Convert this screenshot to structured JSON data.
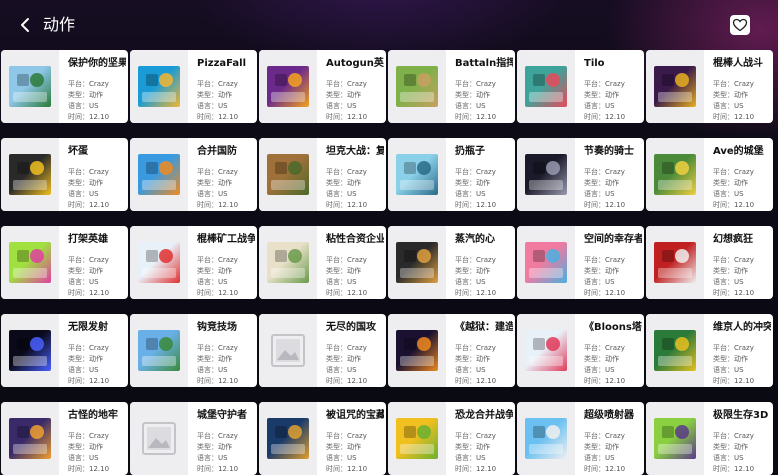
{
  "header": {
    "title": "动作"
  },
  "labels": {
    "platform": "平台：",
    "type": "类型：",
    "lang": "语言：",
    "time": "时间："
  },
  "games": [
    {
      "name": "保护你的坚果",
      "platform": "Crazy",
      "type": "动作",
      "lang": "US",
      "time": "12.10",
      "thumb": "defend-your-nuts",
      "c1": "#8ec7e8",
      "c2": "#2a7a3a"
    },
    {
      "name": "PizzaFall",
      "platform": "Crazy",
      "type": "动作",
      "lang": "US",
      "time": "12.10",
      "thumb": "pizza-fall",
      "c1": "#1a9bd6",
      "c2": "#f2b632"
    },
    {
      "name": "Autogun英雄",
      "platform": "Crazy",
      "type": "动作",
      "lang": "US",
      "time": "12.10",
      "thumb": "autogun-heroes",
      "c1": "#6b2a8a",
      "c2": "#f4a21f"
    },
    {
      "name": "Battaln指挥官",
      "platform": "Crazy",
      "type": "动作",
      "lang": "US",
      "time": "12.10",
      "thumb": "battalion-commander",
      "c1": "#7fb04a",
      "c2": "#c8a060"
    },
    {
      "name": "Tilo",
      "platform": "Crazy",
      "type": "动作",
      "lang": "US",
      "time": "12.10",
      "thumb": "tilo",
      "c1": "#3ea39a",
      "c2": "#e84a5a"
    },
    {
      "name": "棍棒人战斗",
      "platform": "Crazy",
      "type": "动作",
      "lang": "US",
      "time": "12.10",
      "thumb": "stickman-fighting",
      "c1": "#3a1a4a",
      "c2": "#e8b020"
    },
    {
      "name": "坏蛋",
      "platform": "Crazy",
      "type": "动作",
      "lang": "US",
      "time": "12.10",
      "thumb": "bad-egg",
      "c1": "#2a2a2a",
      "c2": "#f0c020"
    },
    {
      "name": "合并国防",
      "platform": "Crazy",
      "type": "动作",
      "lang": "US",
      "time": "12.10",
      "thumb": "merge-defense",
      "c1": "#3a9ae0",
      "c2": "#f08a20"
    },
    {
      "name": "坦克大战：复仇",
      "platform": "Crazy",
      "type": "动作",
      "lang": "US",
      "time": "12.10",
      "thumb": "tank-war",
      "c1": "#a0703a",
      "c2": "#4a6a2a"
    },
    {
      "name": "扔瓶子",
      "platform": "Crazy",
      "type": "动作",
      "lang": "US",
      "time": "12.10",
      "thumb": "bottle-flip",
      "c1": "#8ad0e8",
      "c2": "#2a6a8a"
    },
    {
      "name": "节奏的骑士",
      "platform": "Crazy",
      "type": "动作",
      "lang": "US",
      "time": "12.10",
      "thumb": "rhythm-knight",
      "c1": "#1a1a2a",
      "c2": "#9a9ab0"
    },
    {
      "name": "Ave的城堡",
      "platform": "Crazy",
      "type": "动作",
      "lang": "US",
      "time": "12.10",
      "thumb": "ave-castle",
      "c1": "#4a8a3a",
      "c2": "#f0d040"
    },
    {
      "name": "打架英雄",
      "platform": "Crazy",
      "type": "动作",
      "lang": "US",
      "time": "12.10",
      "thumb": "brawl-hero",
      "c1": "#a0e040",
      "c2": "#e040a0"
    },
    {
      "name": "棍棒矿工战争",
      "platform": "Crazy",
      "type": "动作",
      "lang": "US",
      "time": "12.10",
      "thumb": "stickman-mine-wars",
      "c1": "#e8f0f8",
      "c2": "#e03030"
    },
    {
      "name": "粘性合资企业",
      "platform": "Crazy",
      "type": "动作",
      "lang": "US",
      "time": "12.10",
      "thumb": "sticky-venture",
      "c1": "#e8e0c8",
      "c2": "#6a9a4a"
    },
    {
      "name": "蒸汽的心",
      "platform": "Crazy",
      "type": "动作",
      "lang": "US",
      "time": "12.10",
      "thumb": "steam-hearts",
      "c1": "#2a2a2a",
      "c2": "#e0a040"
    },
    {
      "name": "空间的幸存者",
      "platform": "Crazy",
      "type": "动作",
      "lang": "US",
      "time": "12.10",
      "thumb": "space-survivor",
      "c1": "#f07aa0",
      "c2": "#4ab0e0"
    },
    {
      "name": "幻想疯狂",
      "platform": "Crazy",
      "type": "动作",
      "lang": "US",
      "time": "12.10",
      "thumb": "fantasy-madness",
      "c1": "#c02020",
      "c2": "#f0f0f0"
    },
    {
      "name": "无限发射",
      "platform": "Crazy",
      "type": "动作",
      "lang": "US",
      "time": "12.10",
      "thumb": "infinite-launch",
      "c1": "#0a0a1a",
      "c2": "#4a60ff"
    },
    {
      "name": "钩竞技场",
      "platform": "Crazy",
      "type": "动作",
      "lang": "US",
      "time": "12.10",
      "thumb": "hook-arena",
      "c1": "#6ab0e8",
      "c2": "#3a8a3a"
    },
    {
      "name": "无尽的国攻",
      "platform": "Crazy",
      "type": "动作",
      "lang": "US",
      "time": "12.10",
      "thumb": "placeholder",
      "c1": "#ececee",
      "c2": "#cfcfd4"
    },
    {
      "name": "《越狱：建造》",
      "platform": "Crazy",
      "type": "动作",
      "lang": "US",
      "time": "12.10",
      "thumb": "jailbreak-build",
      "c1": "#1a1030",
      "c2": "#f08a20"
    },
    {
      "name": "《Bloons塔防》",
      "platform": "Crazy",
      "type": "动作",
      "lang": "US",
      "time": "12.10",
      "thumb": "bloons-td",
      "c1": "#e8f0f8",
      "c2": "#e03a5a"
    },
    {
      "name": "维京人的冲突",
      "platform": "Crazy",
      "type": "动作",
      "lang": "US",
      "time": "12.10",
      "thumb": "clash-of-vikings",
      "c1": "#2a7a3a",
      "c2": "#e8c020"
    },
    {
      "name": "古怪的地牢",
      "platform": "Crazy",
      "type": "动作",
      "lang": "US",
      "time": "12.10",
      "thumb": "wacky-dungeon",
      "c1": "#3a2a6a",
      "c2": "#f0a030"
    },
    {
      "name": "城堡守护者",
      "platform": "Crazy",
      "type": "动作",
      "lang": "US",
      "time": "12.10",
      "thumb": "placeholder",
      "c1": "#ececee",
      "c2": "#cfcfd4"
    },
    {
      "name": "被诅咒的宝藏",
      "platform": "Crazy",
      "type": "动作",
      "lang": "US",
      "time": "12.10",
      "thumb": "cursed-treasure",
      "c1": "#1a3a6a",
      "c2": "#e0a030"
    },
    {
      "name": "恐龙合并战争",
      "platform": "Crazy",
      "type": "动作",
      "lang": "US",
      "time": "12.10",
      "thumb": "dino-merge",
      "c1": "#f0c020",
      "c2": "#6ab030"
    },
    {
      "name": "超级喷射器",
      "platform": "Crazy",
      "type": "动作",
      "lang": "US",
      "time": "12.10",
      "thumb": "super-sprayer",
      "c1": "#6ac0f0",
      "c2": "#f0f0f0"
    },
    {
      "name": "极限生存3D",
      "platform": "Crazy",
      "type": "动作",
      "lang": "US",
      "time": "12.10",
      "thumb": "extreme-survival",
      "c1": "#8ad040",
      "c2": "#5a3a8a"
    }
  ]
}
